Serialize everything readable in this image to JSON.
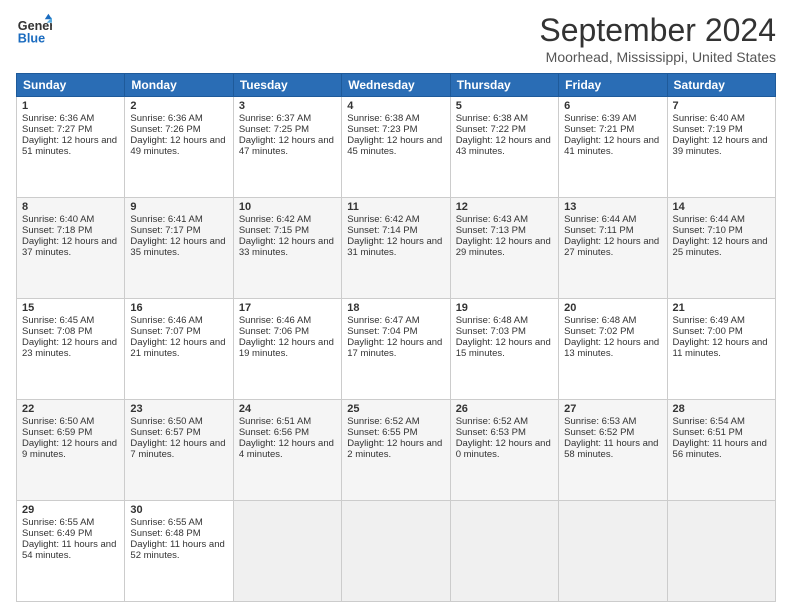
{
  "header": {
    "logo_general": "General",
    "logo_blue": "Blue",
    "month_title": "September 2024",
    "location": "Moorhead, Mississippi, United States"
  },
  "calendar": {
    "days_of_week": [
      "Sunday",
      "Monday",
      "Tuesday",
      "Wednesday",
      "Thursday",
      "Friday",
      "Saturday"
    ],
    "weeks": [
      [
        null,
        {
          "num": "2",
          "sunrise": "Sunrise: 6:36 AM",
          "sunset": "Sunset: 7:26 PM",
          "daylight": "Daylight: 12 hours and 49 minutes."
        },
        {
          "num": "3",
          "sunrise": "Sunrise: 6:37 AM",
          "sunset": "Sunset: 7:25 PM",
          "daylight": "Daylight: 12 hours and 47 minutes."
        },
        {
          "num": "4",
          "sunrise": "Sunrise: 6:38 AM",
          "sunset": "Sunset: 7:23 PM",
          "daylight": "Daylight: 12 hours and 45 minutes."
        },
        {
          "num": "5",
          "sunrise": "Sunrise: 6:38 AM",
          "sunset": "Sunset: 7:22 PM",
          "daylight": "Daylight: 12 hours and 43 minutes."
        },
        {
          "num": "6",
          "sunrise": "Sunrise: 6:39 AM",
          "sunset": "Sunset: 7:21 PM",
          "daylight": "Daylight: 12 hours and 41 minutes."
        },
        {
          "num": "7",
          "sunrise": "Sunrise: 6:40 AM",
          "sunset": "Sunset: 7:19 PM",
          "daylight": "Daylight: 12 hours and 39 minutes."
        }
      ],
      [
        {
          "num": "1",
          "sunrise": "Sunrise: 6:36 AM",
          "sunset": "Sunset: 7:27 PM",
          "daylight": "Daylight: 12 hours and 51 minutes."
        },
        null,
        null,
        null,
        null,
        null,
        null
      ],
      [
        {
          "num": "8",
          "sunrise": "Sunrise: 6:40 AM",
          "sunset": "Sunset: 7:18 PM",
          "daylight": "Daylight: 12 hours and 37 minutes."
        },
        {
          "num": "9",
          "sunrise": "Sunrise: 6:41 AM",
          "sunset": "Sunset: 7:17 PM",
          "daylight": "Daylight: 12 hours and 35 minutes."
        },
        {
          "num": "10",
          "sunrise": "Sunrise: 6:42 AM",
          "sunset": "Sunset: 7:15 PM",
          "daylight": "Daylight: 12 hours and 33 minutes."
        },
        {
          "num": "11",
          "sunrise": "Sunrise: 6:42 AM",
          "sunset": "Sunset: 7:14 PM",
          "daylight": "Daylight: 12 hours and 31 minutes."
        },
        {
          "num": "12",
          "sunrise": "Sunrise: 6:43 AM",
          "sunset": "Sunset: 7:13 PM",
          "daylight": "Daylight: 12 hours and 29 minutes."
        },
        {
          "num": "13",
          "sunrise": "Sunrise: 6:44 AM",
          "sunset": "Sunset: 7:11 PM",
          "daylight": "Daylight: 12 hours and 27 minutes."
        },
        {
          "num": "14",
          "sunrise": "Sunrise: 6:44 AM",
          "sunset": "Sunset: 7:10 PM",
          "daylight": "Daylight: 12 hours and 25 minutes."
        }
      ],
      [
        {
          "num": "15",
          "sunrise": "Sunrise: 6:45 AM",
          "sunset": "Sunset: 7:08 PM",
          "daylight": "Daylight: 12 hours and 23 minutes."
        },
        {
          "num": "16",
          "sunrise": "Sunrise: 6:46 AM",
          "sunset": "Sunset: 7:07 PM",
          "daylight": "Daylight: 12 hours and 21 minutes."
        },
        {
          "num": "17",
          "sunrise": "Sunrise: 6:46 AM",
          "sunset": "Sunset: 7:06 PM",
          "daylight": "Daylight: 12 hours and 19 minutes."
        },
        {
          "num": "18",
          "sunrise": "Sunrise: 6:47 AM",
          "sunset": "Sunset: 7:04 PM",
          "daylight": "Daylight: 12 hours and 17 minutes."
        },
        {
          "num": "19",
          "sunrise": "Sunrise: 6:48 AM",
          "sunset": "Sunset: 7:03 PM",
          "daylight": "Daylight: 12 hours and 15 minutes."
        },
        {
          "num": "20",
          "sunrise": "Sunrise: 6:48 AM",
          "sunset": "Sunset: 7:02 PM",
          "daylight": "Daylight: 12 hours and 13 minutes."
        },
        {
          "num": "21",
          "sunrise": "Sunrise: 6:49 AM",
          "sunset": "Sunset: 7:00 PM",
          "daylight": "Daylight: 12 hours and 11 minutes."
        }
      ],
      [
        {
          "num": "22",
          "sunrise": "Sunrise: 6:50 AM",
          "sunset": "Sunset: 6:59 PM",
          "daylight": "Daylight: 12 hours and 9 minutes."
        },
        {
          "num": "23",
          "sunrise": "Sunrise: 6:50 AM",
          "sunset": "Sunset: 6:57 PM",
          "daylight": "Daylight: 12 hours and 7 minutes."
        },
        {
          "num": "24",
          "sunrise": "Sunrise: 6:51 AM",
          "sunset": "Sunset: 6:56 PM",
          "daylight": "Daylight: 12 hours and 4 minutes."
        },
        {
          "num": "25",
          "sunrise": "Sunrise: 6:52 AM",
          "sunset": "Sunset: 6:55 PM",
          "daylight": "Daylight: 12 hours and 2 minutes."
        },
        {
          "num": "26",
          "sunrise": "Sunrise: 6:52 AM",
          "sunset": "Sunset: 6:53 PM",
          "daylight": "Daylight: 12 hours and 0 minutes."
        },
        {
          "num": "27",
          "sunrise": "Sunrise: 6:53 AM",
          "sunset": "Sunset: 6:52 PM",
          "daylight": "Daylight: 11 hours and 58 minutes."
        },
        {
          "num": "28",
          "sunrise": "Sunrise: 6:54 AM",
          "sunset": "Sunset: 6:51 PM",
          "daylight": "Daylight: 11 hours and 56 minutes."
        }
      ],
      [
        {
          "num": "29",
          "sunrise": "Sunrise: 6:55 AM",
          "sunset": "Sunset: 6:49 PM",
          "daylight": "Daylight: 11 hours and 54 minutes."
        },
        {
          "num": "30",
          "sunrise": "Sunrise: 6:55 AM",
          "sunset": "Sunset: 6:48 PM",
          "daylight": "Daylight: 11 hours and 52 minutes."
        },
        null,
        null,
        null,
        null,
        null
      ]
    ]
  }
}
